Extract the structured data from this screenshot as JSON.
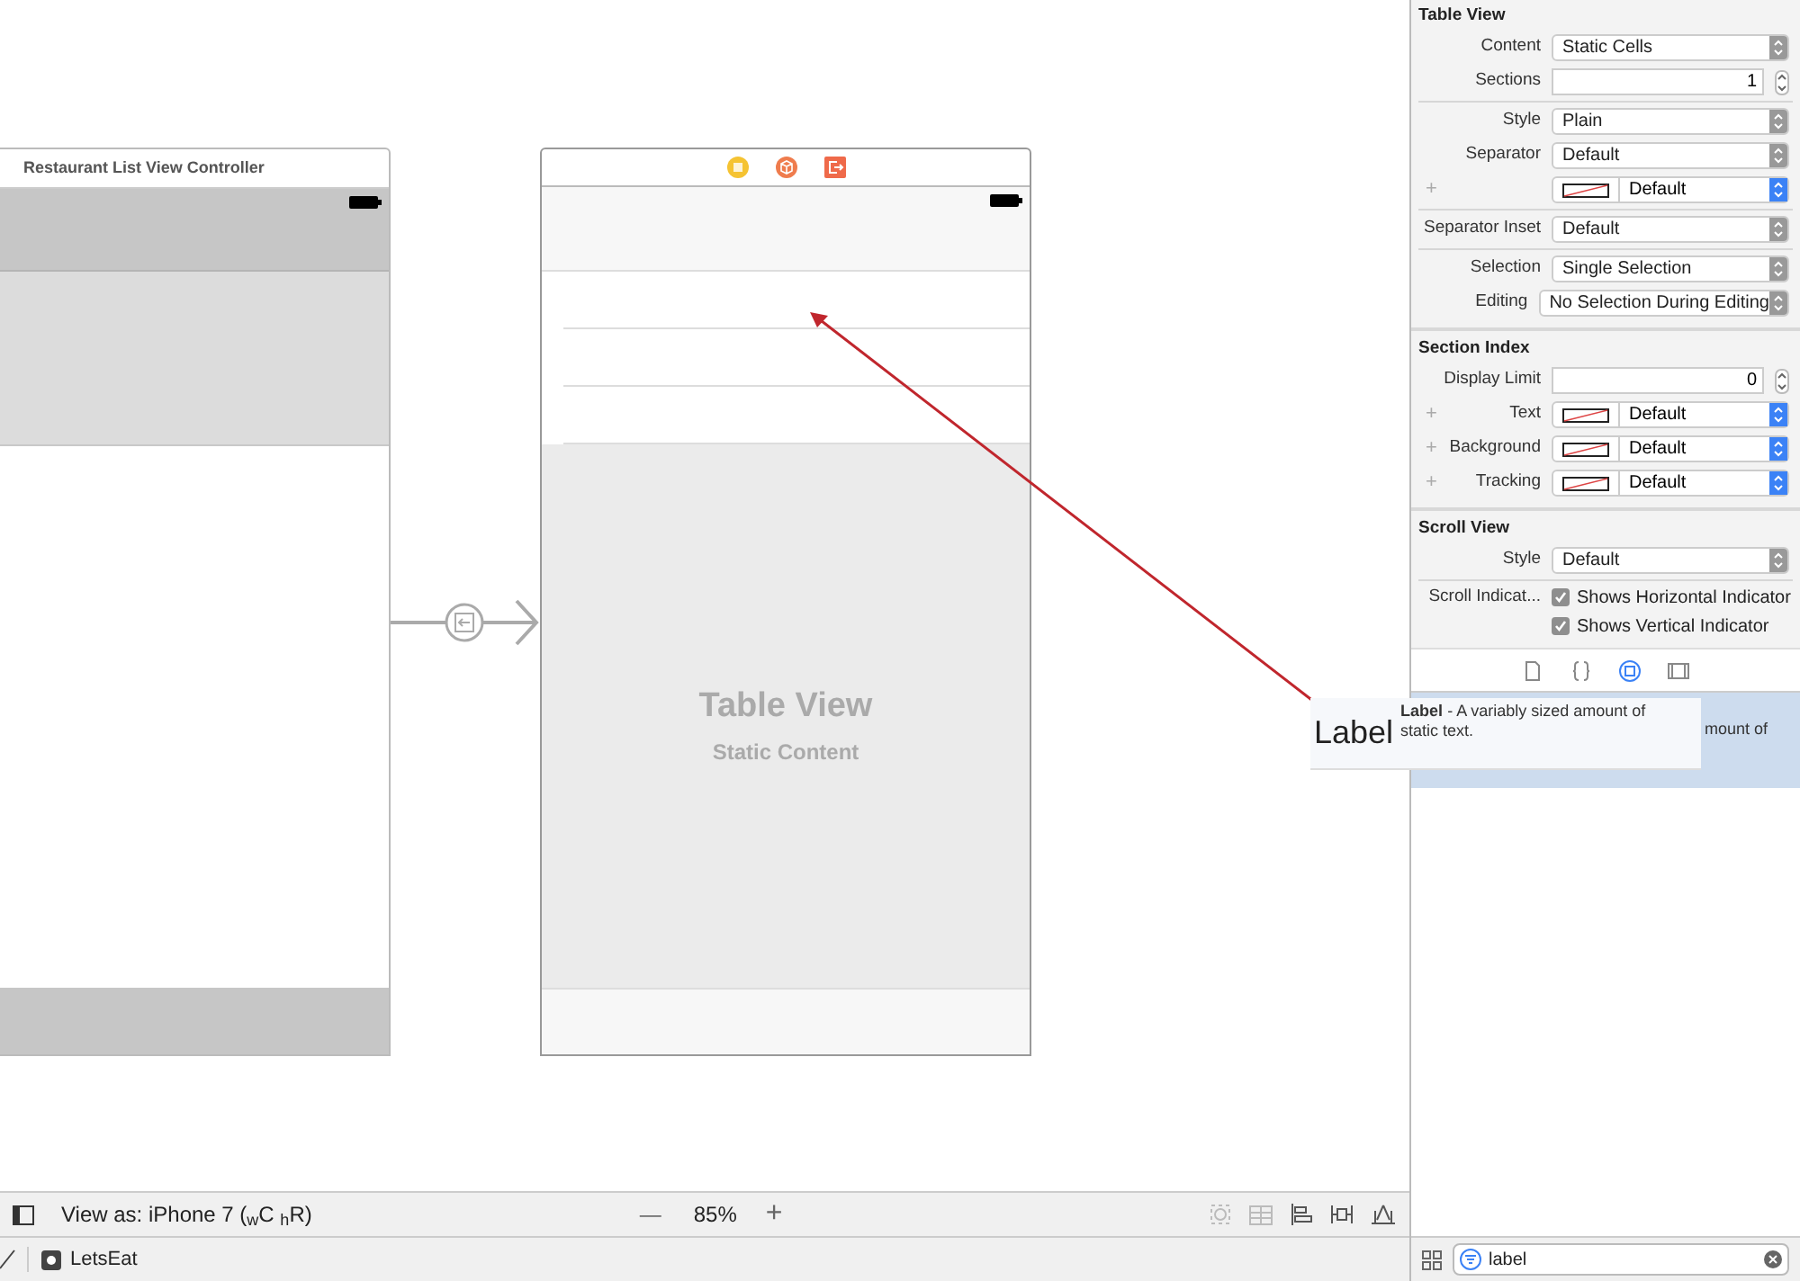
{
  "canvas": {
    "scenes": [
      {
        "kind": "controller",
        "title": "Restaurant List View Controller"
      },
      {
        "kind": "table",
        "placeholder_title": "Table View",
        "placeholder_subtitle": "Static Content"
      }
    ],
    "drag": {
      "big_label": "Label",
      "description": "**Label** - A variably sized amount of static text."
    }
  },
  "bottom_bar": {
    "view_as": "View as: iPhone 7 ($_{w}$C $_{h}$R)",
    "zoom_minus": "—",
    "zoom": "85%",
    "zoom_plus": "+"
  },
  "breadcrumb": {
    "item": "LetsEat"
  },
  "inspector": {
    "sections": [
      {
        "title": "Table View",
        "groups": [
          [
            {
              "kind": "popup",
              "label": "Content",
              "value": "Static Cells"
            },
            {
              "kind": "stepper",
              "label": "Sections",
              "value": "1"
            }
          ],
          [
            {
              "kind": "popup",
              "label": "Style",
              "value": "Plain"
            },
            {
              "kind": "popup",
              "label": "Separator",
              "value": "Default"
            },
            {
              "kind": "color",
              "label": "+",
              "value": "Default"
            }
          ],
          [
            {
              "kind": "popup",
              "label": "Separator Inset",
              "value": "Default"
            }
          ],
          [
            {
              "kind": "popup",
              "label": "Selection",
              "value": "Single Selection"
            },
            {
              "kind": "popup",
              "label": "Editing",
              "value": "No Selection During Editing"
            }
          ]
        ]
      },
      {
        "title": "Section Index",
        "groups": [
          [
            {
              "kind": "stepper",
              "label": "Display Limit",
              "value": "0"
            },
            {
              "kind": "color",
              "plus": "+",
              "label": "Text",
              "value": "Default"
            },
            {
              "kind": "color",
              "plus": "+",
              "label": "Background",
              "value": "Default"
            },
            {
              "kind": "color",
              "plus": "+",
              "label": "Tracking",
              "value": "Default"
            }
          ]
        ]
      },
      {
        "title": "Scroll View",
        "groups": [
          [
            {
              "kind": "popup",
              "label": "Style",
              "value": "Default"
            }
          ],
          [
            {
              "kind": "checkbox",
              "label": "Scroll Indicat...",
              "value": "Shows Horizontal Indicator",
              "checked": true
            },
            {
              "kind": "checkbox",
              "value": "Shows Vertical Indicator",
              "checked": true
            }
          ]
        ]
      }
    ],
    "library_tabs": [
      {
        "kind": "file",
        "selected": false
      },
      {
        "kind": "braces",
        "selected": false
      },
      {
        "kind": "object",
        "selected": true
      },
      {
        "kind": "media",
        "selected": false
      }
    ],
    "library_items": [
      {
        "description": "mount of",
        "selected": true
      }
    ],
    "filter": {
      "value": "label"
    }
  }
}
